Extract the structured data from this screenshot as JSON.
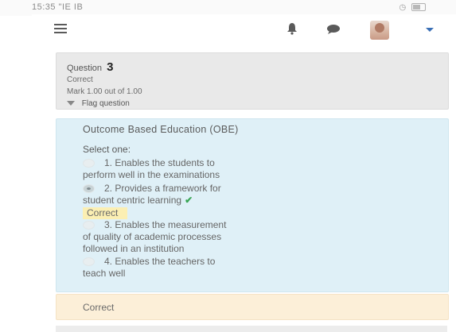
{
  "status_bar": {
    "time": "15:35 \"ΙΕ ΙΒ"
  },
  "question": {
    "label": "Question",
    "number": "3",
    "state": "Correct",
    "mark": "Mark 1.00 out of 1.00",
    "flag": "Flag question",
    "text": "Outcome Based Education (OBE)",
    "prompt": "Select one:",
    "options": [
      {
        "line1": "1. Enables the students to",
        "line2": "perform well in the examinations",
        "selected": false
      },
      {
        "line1": "2. Provides a framework for",
        "line2": "student centric learning",
        "selected": true,
        "badge": "Correct"
      },
      {
        "line1": "3. Enables the measurement",
        "line2": "of quality of academic processes",
        "line3": "followed in an institution",
        "selected": false
      },
      {
        "line1": "4. Enables the teachers to",
        "line2": "teach well",
        "selected": false
      }
    ],
    "feedback": "Correct"
  },
  "icons": {
    "menu": "hamburger-icon",
    "notifications": "bell-icon",
    "messages": "chat-bubble-icon",
    "user": "avatar",
    "dropdown": "caret-down-icon",
    "flag": "flag-icon",
    "correct": "check-mark-icon"
  },
  "colors": {
    "question_info_bg": "#e9e9e9",
    "formulation_bg": "#dff0f7",
    "feedback_bg": "#fcefd8",
    "correct_badge_bg": "#fbefb3",
    "check_color": "#3aa655",
    "caret_color": "#3a6fb5"
  }
}
